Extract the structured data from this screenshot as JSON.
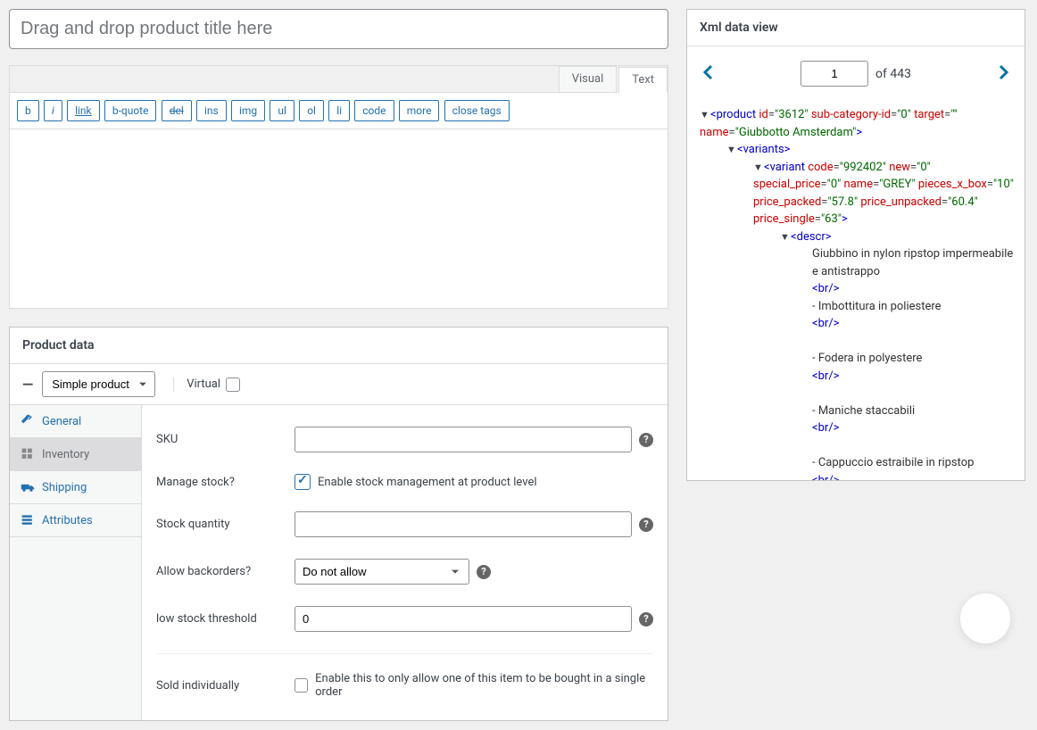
{
  "title_placeholder": "Drag and drop product title here",
  "editor": {
    "tabs": {
      "visual": "Visual",
      "text": "Text"
    },
    "quicktags": [
      "b",
      "i",
      "link",
      "b-quote",
      "del",
      "ins",
      "img",
      "ul",
      "ol",
      "li",
      "code",
      "more",
      "close tags"
    ]
  },
  "product_data": {
    "title": "Product data",
    "type_selected": "Simple product",
    "virtual_label": "Virtual",
    "tabs": {
      "general": "General",
      "inventory": "Inventory",
      "shipping": "Shipping",
      "attributes": "Attributes"
    },
    "fields": {
      "sku_label": "SKU",
      "sku_value": "",
      "manage_stock_label": "Manage stock?",
      "manage_stock_text": "Enable stock management at product level",
      "stock_qty_label": "Stock quantity",
      "stock_qty_value": "",
      "backorders_label": "Allow backorders?",
      "backorders_selected": "Do not allow",
      "low_stock_label": "low stock threshold",
      "low_stock_value": "0",
      "sold_individually_label": "Sold individually",
      "sold_individually_text": "Enable this to only allow one of this item to be bought in a single order"
    }
  },
  "xml_view": {
    "title": "Xml data view",
    "page": "1",
    "total": "of 443",
    "tree": {
      "product": {
        "id": "3612",
        "sub_category_id": "0",
        "target": "",
        "name": "Giubbotto Amsterdam"
      },
      "variant": {
        "code": "992402",
        "new": "0",
        "special_price": "0",
        "name": "GREY",
        "pieces_x_box": "10",
        "price_packed": "57.8",
        "price_unpacked": "60.4",
        "price_single": "63"
      },
      "descr_lines": [
        "Giubbino in nylon ripstop impermeabile e antistrappo",
        "<br/>",
        "- Imbottitura in poliestere",
        "<br/>",
        "",
        "- Fodera in polyestere",
        "<br/>",
        "",
        "- Maniche staccabili",
        "<br/>",
        "",
        "- Cappuccio estraibile in ripstop",
        "<br/>"
      ]
    }
  }
}
